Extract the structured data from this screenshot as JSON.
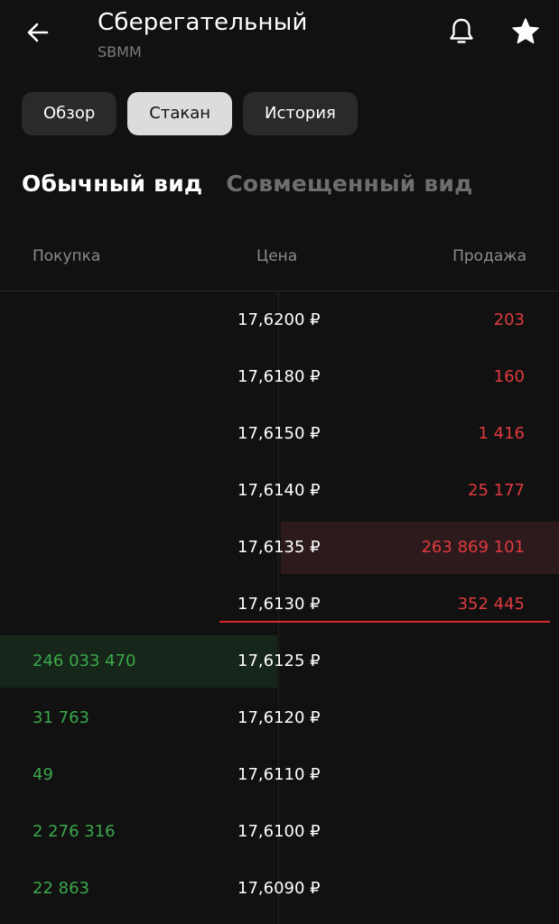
{
  "header": {
    "title": "Сберегательный",
    "ticker": "SBMM",
    "icons": {
      "back": "arrow-left-icon",
      "notify": "bell-icon",
      "favorite": "star-icon"
    }
  },
  "tabs": [
    {
      "label": "Обзор",
      "active": false
    },
    {
      "label": "Стакан",
      "active": true
    },
    {
      "label": "История",
      "active": false
    }
  ],
  "views": {
    "normal": "Обычный вид",
    "combined": "Совмещенный вид"
  },
  "columns": {
    "buy": "Покупка",
    "price": "Цена",
    "sell": "Продажа"
  },
  "colors": {
    "sell": "#e03a3e",
    "buy": "#3aa84a",
    "background": "#111111"
  },
  "asks": [
    {
      "price": "17,6200 ₽",
      "volume": "203"
    },
    {
      "price": "17,6180 ₽",
      "volume": "160"
    },
    {
      "price": "17,6150 ₽",
      "volume": "1 416"
    },
    {
      "price": "17,6140 ₽",
      "volume": "25 177"
    },
    {
      "price": "17,6135 ₽",
      "volume": "263 869 101"
    },
    {
      "price": "17,6130 ₽",
      "volume": "352 445"
    }
  ],
  "bids": [
    {
      "price": "17,6125 ₽",
      "volume": "246 033 470"
    },
    {
      "price": "17,6120 ₽",
      "volume": "31 763"
    },
    {
      "price": "17,6110 ₽",
      "volume": "49"
    },
    {
      "price": "17,6100 ₽",
      "volume": "2 276 316"
    },
    {
      "price": "17,6090 ₽",
      "volume": "22 863"
    }
  ]
}
